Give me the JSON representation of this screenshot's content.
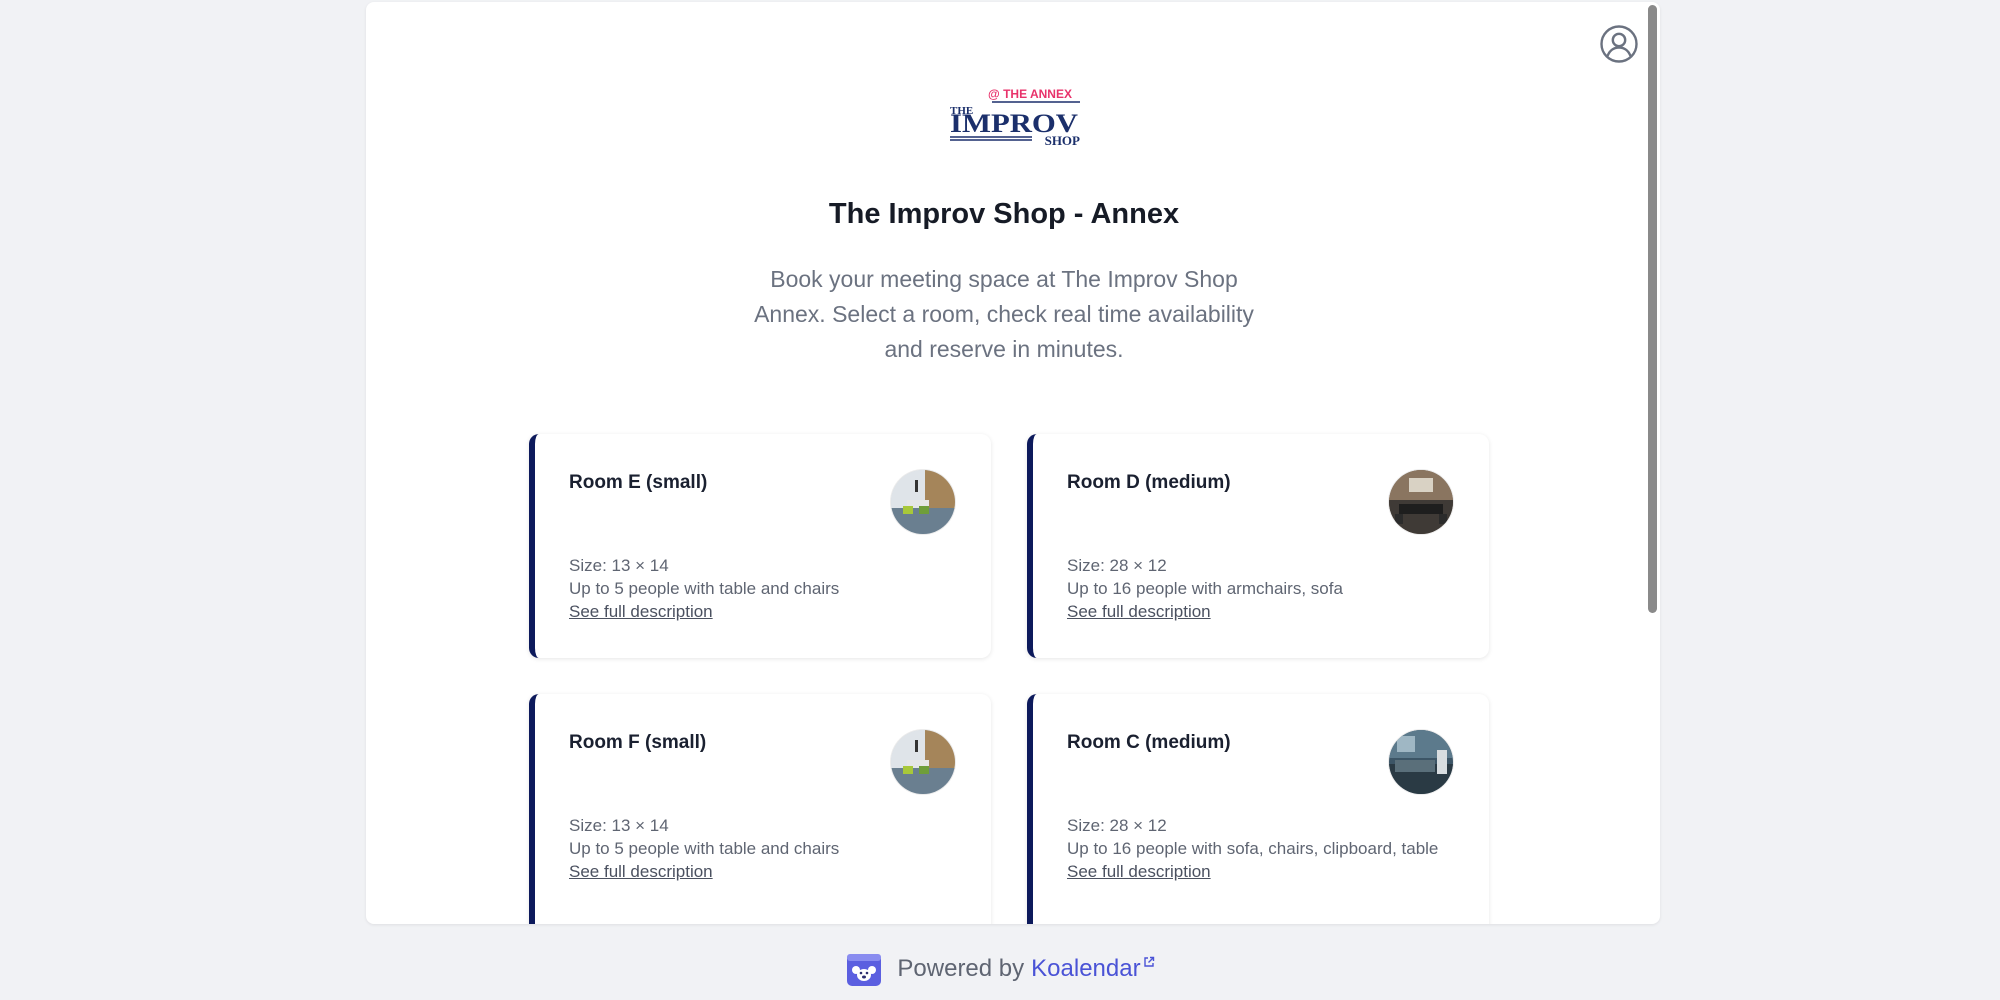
{
  "page": {
    "title": "The Improv Shop - Annex",
    "subtitle": "Book your meeting space at The Improv Shop Annex. Select a room, check real time availability and reserve in minutes."
  },
  "logo": {
    "top_text": "@ THE ANNEX",
    "line1": "THE",
    "line2": "IMPROV",
    "line3": "SHOP"
  },
  "header": {
    "account_icon": "user-circle-icon"
  },
  "rooms": [
    {
      "name": "Room E (small)",
      "size": "Size: 13 × 14",
      "capacity": "Up to 5 people with table and chairs",
      "link": "See full description"
    },
    {
      "name": "Room D (medium)",
      "size": "Size: 28 × 12",
      "capacity": "Up to 16 people with armchairs, sofa",
      "link": "See full description"
    },
    {
      "name": "Room F (small)",
      "size": "Size: 13 × 14",
      "capacity": "Up to 5 people with table and chairs",
      "link": "See full description"
    },
    {
      "name": "Room C (medium)",
      "size": "Size: 28 × 12",
      "capacity": "Up to 16 people with sofa, chairs, clipboard, table",
      "link": "See full description"
    }
  ],
  "footer": {
    "powered_by": "Powered by",
    "brand": "Koalendar",
    "external_icon": "external-link-icon"
  },
  "colors": {
    "card_accent": "#0d1a5c",
    "brand_link": "#4a53d6",
    "logo_navy": "#1b2f6b",
    "logo_pink": "#e8336b"
  }
}
